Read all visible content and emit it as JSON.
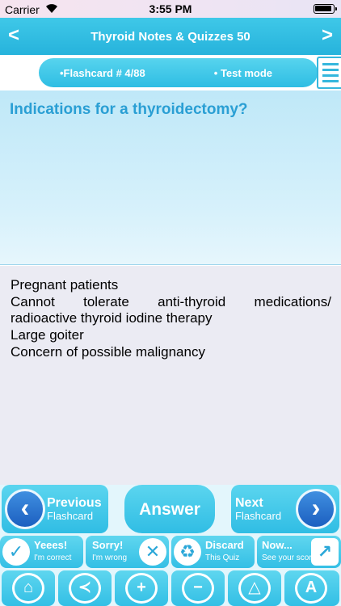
{
  "status_bar": {
    "carrier": "Carrier",
    "time": "3:55 PM"
  },
  "nav": {
    "title": "Thyroid Notes & Quizzes 50",
    "back_glyph": "<",
    "forward_glyph": ">"
  },
  "mode_bar": {
    "flashcard_label": "•Flashcard #  4/88",
    "test_mode_label": "• Test mode"
  },
  "question": {
    "text": "Indications for a thyroidectomy?"
  },
  "answer": {
    "lines": [
      "Pregnant patients",
      "Cannot tolerate anti-thyroid medications/",
      "radioactive thyroid iodine therapy",
      "Large goiter",
      "Concern of possible malignancy"
    ]
  },
  "actions": {
    "previous": {
      "line1": "Previous",
      "line2": "Flashcard"
    },
    "answer": {
      "label": "Answer"
    },
    "next": {
      "line1": "Next",
      "line2": "Flashcard"
    }
  },
  "small_buttons": [
    {
      "title": "Yeees!",
      "subtitle": "I'm correct",
      "icon": "check-icon"
    },
    {
      "title": "Sorry!",
      "subtitle": "I'm wrong",
      "icon": "cross-icon"
    },
    {
      "title": "Discard",
      "subtitle": "This Quiz",
      "icon": "recycle-icon"
    },
    {
      "title": "Now...",
      "subtitle": "See your score",
      "icon": "chart-icon"
    }
  ],
  "toolbar_icons": [
    "home-icon",
    "share-icon",
    "zoom-in-icon",
    "zoom-out-icon",
    "bucket-icon",
    "font-icon"
  ],
  "colors": {
    "accent": "#2ebde3",
    "question_text": "#2a9fd4",
    "circle_blue": "#1c5fc0"
  }
}
